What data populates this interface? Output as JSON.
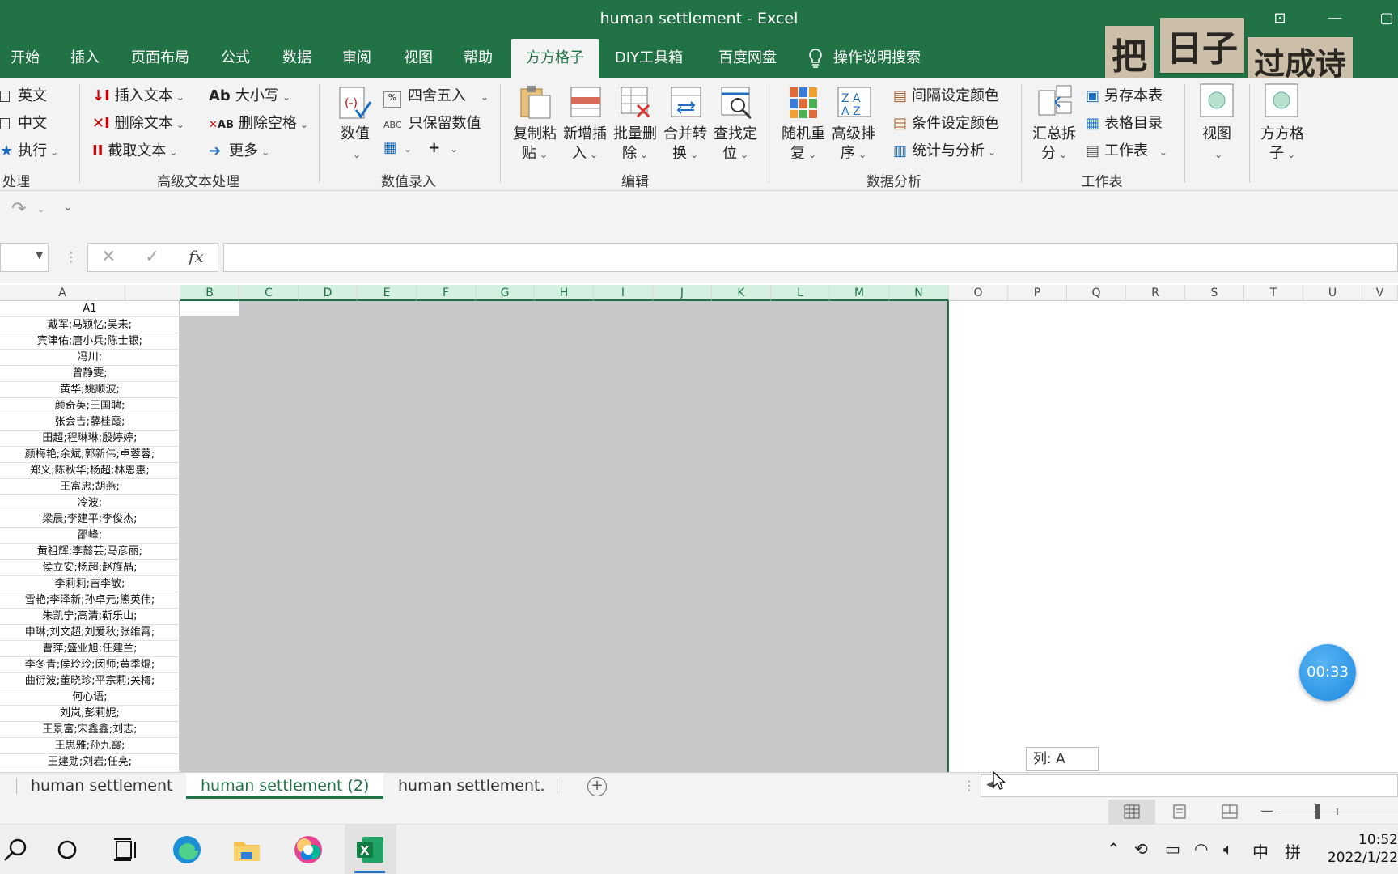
{
  "window": {
    "title": "human settlement  -  Excel"
  },
  "deco": {
    "chars1": "把",
    "chars2": "日子",
    "chars3": "过成诗"
  },
  "tabs": [
    "开始",
    "插入",
    "页面布局",
    "公式",
    "数据",
    "审阅",
    "视图",
    "帮助",
    "方方格子",
    "DIY工具箱",
    "百度网盘",
    "操作说明搜索"
  ],
  "active_tab": "方方格子",
  "ribbon": {
    "g0": {
      "items": [
        "英文",
        "中文",
        "执行"
      ],
      "label": "处理"
    },
    "g1": {
      "items": [
        "插入文本",
        "删除文本",
        "截取文本",
        "大小写",
        "删除空格",
        "更多"
      ],
      "label": "高级文本处理"
    },
    "g2": {
      "items": [
        "数值",
        "四舍五入",
        "只保留数值"
      ],
      "label": "数值录入"
    },
    "g3": {
      "items": [
        "复制粘",
        "贴",
        "新增插",
        "入",
        "批量删",
        "除",
        "合并转",
        "换",
        "查找定",
        "位"
      ],
      "label": "编辑"
    },
    "g4": {
      "items": [
        "随机重",
        "复",
        "高级排",
        "序",
        "间隔设定颜色",
        "条件设定颜色",
        "统计与分析"
      ],
      "label": "数据分析"
    },
    "g5": {
      "items": [
        "汇总拆",
        "分",
        "另存本表",
        "表格目录",
        "工作表"
      ],
      "label": "工作表"
    },
    "g6": {
      "items": [
        "视图",
        "方方格",
        "子"
      ]
    }
  },
  "formula_bar": {
    "fx": "fx",
    "value": ""
  },
  "columns": [
    "A",
    "B",
    "C",
    "D",
    "E",
    "F",
    "G",
    "H",
    "I",
    "J",
    "K",
    "L",
    "M",
    "N",
    "O",
    "P",
    "Q",
    "R",
    "S",
    "T",
    "U",
    "V"
  ],
  "cells_a": [
    "A1",
    "戴军;马颖忆;吴未;",
    "宾津佑;唐小兵;陈士银;",
    "冯川;",
    "曾静雯;",
    "黄华;姚顺波;",
    "颜奇英;王国聘;",
    "张会吉;薛桂霞;",
    "田超;程琳琳;殷婷婷;",
    "颜梅艳;余斌;郭新伟;卓蓉蓉;",
    "郑义;陈秋华;杨超;林恩惠;",
    "王富忠;胡燕;",
    "冷波;",
    "梁晨;李建平;李俊杰;",
    "邵峰;",
    "黄祖辉;李懿芸;马彦丽;",
    "侯立安;杨超;赵旌晶;",
    "李莉莉;吉李敏;",
    "雪艳;李泽新;孙卓元;熊英伟;",
    "朱凯宁;高清;靳乐山;",
    "申琳;刘文超;刘爱秋;张维霄;",
    "曹萍;盛业旭;任建兰;",
    "李冬青;侯玲玲;闵师;黄季焜;",
    "曲衍波;董晓珍;平宗莉;关梅;",
    "何心语;",
    "刘岚;彭莉妮;",
    "王景富;宋鑫鑫;刘志;",
    "王思雅;孙九霞;",
    "王建勋;刘岩;任亮;"
  ],
  "sheets": [
    "human settlement",
    "human settlement (2)",
    "human settlement."
  ],
  "active_sheet": "human settlement (2)",
  "tooltip": "列: A",
  "timer": "00:33",
  "taskbar": {
    "lang1": "中",
    "lang2": "拼",
    "time": "10:52",
    "date": "2022/1/22"
  }
}
